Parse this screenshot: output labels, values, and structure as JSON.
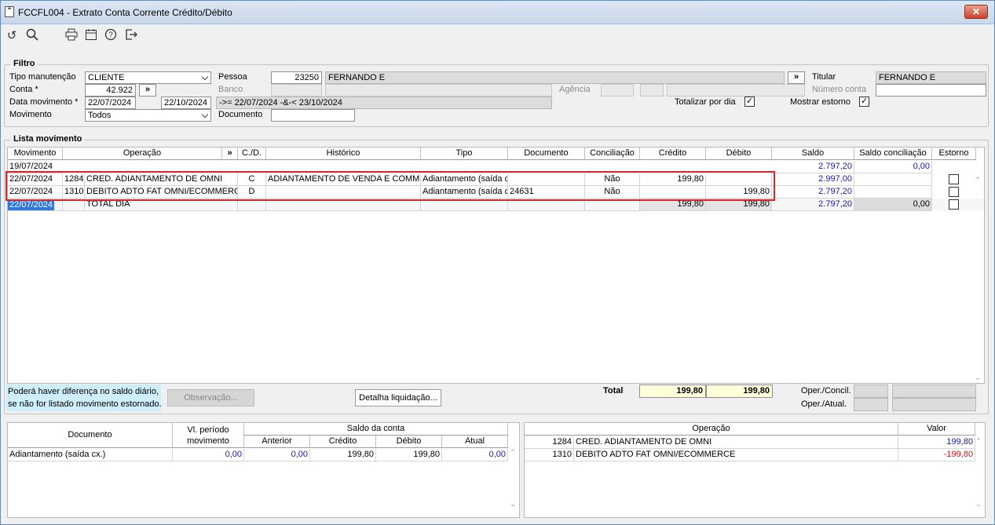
{
  "window": {
    "title": "FCCFL004 - Extrato Conta Corrente Crédito/Débito",
    "close_label": "✕"
  },
  "toolbar": {
    "icons": [
      "undo-icon",
      "search-icon",
      "print-icon",
      "calendar-icon",
      "help-icon",
      "exit-icon"
    ]
  },
  "filtro": {
    "title": "Filtro",
    "tipo_manutencao_label": "Tipo manutenção",
    "tipo_manutencao_value": "CLIENTE",
    "conta_label": "Conta *",
    "conta_value": "42.922",
    "conta_btn": "»",
    "data_movimento_label": "Data movimento *",
    "data_inicio": "22/07/2024",
    "data_fim": "22/10/2024",
    "data_expr": "->= 22/07/2024 -&-< 23/10/2024",
    "movimento_label": "Movimento",
    "movimento_value": "Todos",
    "pessoa_label": "Pessoa",
    "pessoa_codigo": "23250",
    "pessoa_nome": "FERNANDO E",
    "pessoa_btn": "»",
    "banco_label": "Banco",
    "agencia_label": "Agência",
    "documento_label": "Documento",
    "documento_value": "",
    "titular_label": "Titular",
    "titular_value": "FERNANDO E",
    "numero_conta_label": "Número conta",
    "totalizar_label": "Totalizar por dia",
    "totalizar_checked": true,
    "mostrar_estorno_label": "Mostrar estorno",
    "mostrar_estorno_checked": true
  },
  "lista": {
    "title": "Lista movimento",
    "columns": [
      "Movimento",
      "Operação",
      "»",
      "C./D.",
      "Histórico",
      "Tipo",
      "Documento",
      "Conciliação",
      "Crédito",
      "Débito",
      "Saldo",
      "Saldo conciliação",
      "Estorno"
    ],
    "rows": [
      {
        "movimento": "19/07/2024",
        "codigo": "",
        "operacao": "",
        "cd": "",
        "historico": "",
        "tipo": "",
        "documento": "",
        "conciliacao": "",
        "credito": "",
        "debito": "",
        "saldo": "2.797,20",
        "saldo_conc": "0,00",
        "estorno": null
      },
      {
        "movimento": "22/07/2024",
        "codigo": "1284",
        "operacao": "CRED. ADIANTAMENTO DE OMNI",
        "cd": "C",
        "historico": "ADIANTAMENTO DE VENDA E COMMERCE",
        "tipo": "Adiantamento (saída cx.)",
        "documento": "",
        "conciliacao": "Não",
        "credito": "199,80",
        "debito": "",
        "saldo": "2.997,00",
        "saldo_conc": "",
        "estorno": false
      },
      {
        "movimento": "22/07/2024",
        "codigo": "1310",
        "operacao": "DEBITO ADTO FAT OMNI/ECOMMERCE",
        "cd": "D",
        "historico": "",
        "tipo": "Adiantamento (saída cx.)",
        "documento": "24631",
        "conciliacao": "Não",
        "credito": "",
        "debito": "199,80",
        "saldo": "2.797,20",
        "saldo_conc": "",
        "estorno": false
      },
      {
        "movimento": "22/07/2024",
        "codigo": "",
        "operacao": "TOTAL DIA",
        "cd": "",
        "historico": "",
        "tipo": "",
        "documento": "",
        "conciliacao": "",
        "credito": "199,80",
        "debito": "199,80",
        "saldo": "2.797,20",
        "saldo_conc": "0,00",
        "estorno": false
      }
    ],
    "note": "Poderá haver diferença no saldo diário,\nse não for listado movimento estornado.",
    "observacao_btn": "Observação...",
    "detalha_btn": "Detalha liquidação...",
    "total_label": "Total",
    "total_credito": "199,80",
    "total_debito": "199,80",
    "oper_concil_label": "Oper./Concil.",
    "oper_atual_label": "Oper./Atual."
  },
  "documento_grid": {
    "col_documento": "Documento",
    "col_vl_periodo": "Vl. período movimento",
    "col_saldo_conta": "Saldo da conta",
    "sub_anterior": "Anterior",
    "sub_credito": "Crédito",
    "sub_debito": "Débito",
    "sub_atual": "Atual",
    "rows": [
      {
        "documento": "Adiantamento (saída cx.)",
        "vl_periodo": "0,00",
        "anterior": "0,00",
        "credito": "199,80",
        "debito": "199,80",
        "atual": "0,00"
      }
    ]
  },
  "operacao_grid": {
    "col_operacao": "Operação",
    "col_valor": "Valor",
    "rows": [
      {
        "codigo": "1284",
        "operacao": "CRED. ADIANTAMENTO DE OMNI",
        "valor": "199,80"
      },
      {
        "codigo": "1310",
        "operacao": "DEBITO ADTO FAT OMNI/ECOMMERCE",
        "valor": "-199,80"
      }
    ]
  },
  "colors": {
    "highlight_border": "#d9262b",
    "total_yellow": "#ffffd9",
    "note_bg": "#cdeefa",
    "selection": "#3376d9"
  }
}
